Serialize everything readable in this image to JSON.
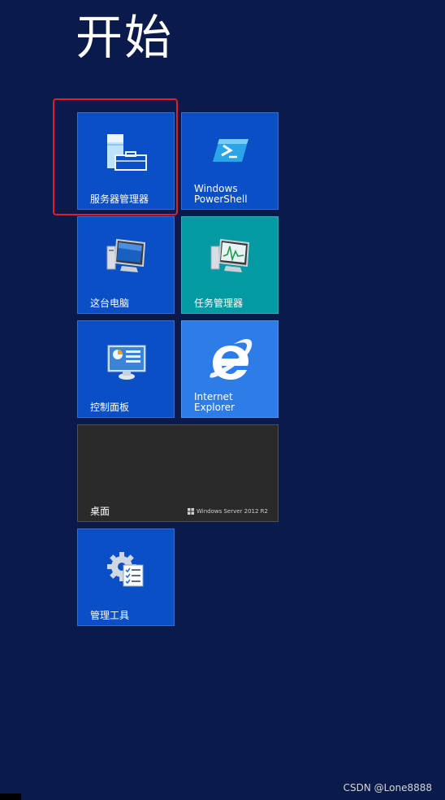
{
  "screen": {
    "title": "开始"
  },
  "tiles": [
    {
      "label": "服务器管理器",
      "icon": "server-manager-icon"
    },
    {
      "label": "Windows\nPowerShell",
      "icon": "powershell-icon"
    },
    {
      "label": "这台电脑",
      "icon": "computer-icon"
    },
    {
      "label": "任务管理器",
      "icon": "task-manager-icon"
    },
    {
      "label": "控制面板",
      "icon": "control-panel-icon"
    },
    {
      "label": "Internet\nExplorer",
      "icon": "ie-icon"
    },
    {
      "label": "桌面",
      "brand": "Windows Server 2012 R2",
      "icon": "windows-logo-icon"
    },
    {
      "label": "管理工具",
      "icon": "admin-tools-icon"
    }
  ],
  "watermark": "CSDN @Lone8888",
  "colors": {
    "background": "#0a1a4a",
    "tile_blue": "#0b4fc6",
    "tile_teal": "#049aa3",
    "tile_ie": "#2d7ce8",
    "tile_desktop": "#2a2a2a",
    "highlight": "#e02020"
  }
}
